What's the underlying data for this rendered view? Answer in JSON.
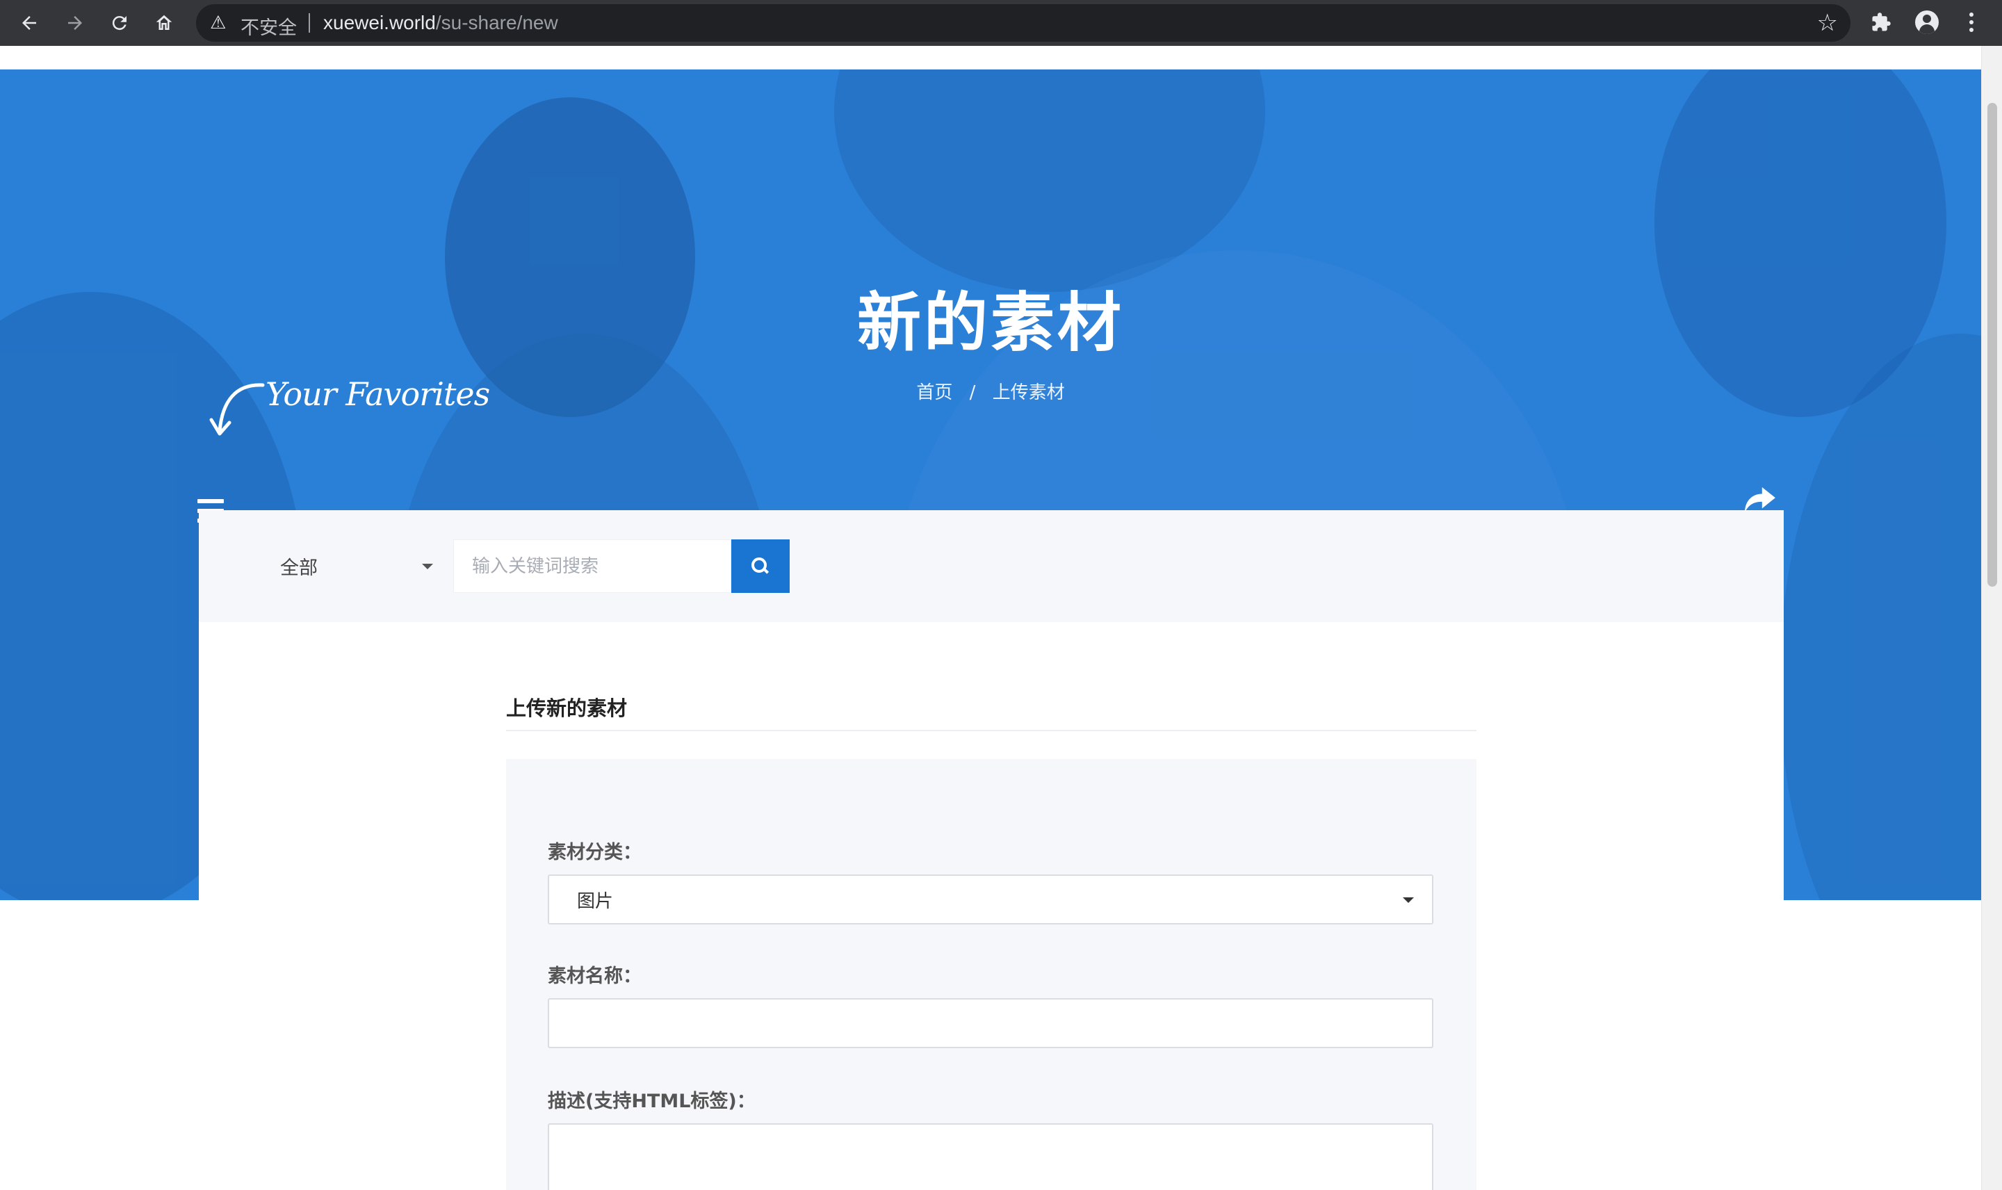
{
  "browser": {
    "security_label": "不安全",
    "url_host": "xuewei.world",
    "url_path": "/su-share/new",
    "icons": [
      "back-arrow-icon",
      "forward-arrow-icon",
      "reload-icon",
      "home-icon",
      "warning-icon",
      "star-icon",
      "extensions-puzzle-icon",
      "profile-avatar-icon",
      "more-vert-icon"
    ]
  },
  "hero": {
    "title": "新的素材",
    "breadcrumb": {
      "home": "首页",
      "separator": "/",
      "current": "上传素材"
    },
    "favorites_text": "Your Favorites",
    "background_color": "#2a7fd6"
  },
  "search": {
    "category_selected": "全部",
    "placeholder": "输入关键词搜索",
    "button_color": "#1a74d1"
  },
  "form": {
    "section_title": "上传新的素材",
    "category_label": "素材分类：",
    "category_value": "图片",
    "name_label": "素材名称：",
    "name_value": "",
    "description_label": "描述(支持HTML标签)：",
    "description_value": ""
  }
}
